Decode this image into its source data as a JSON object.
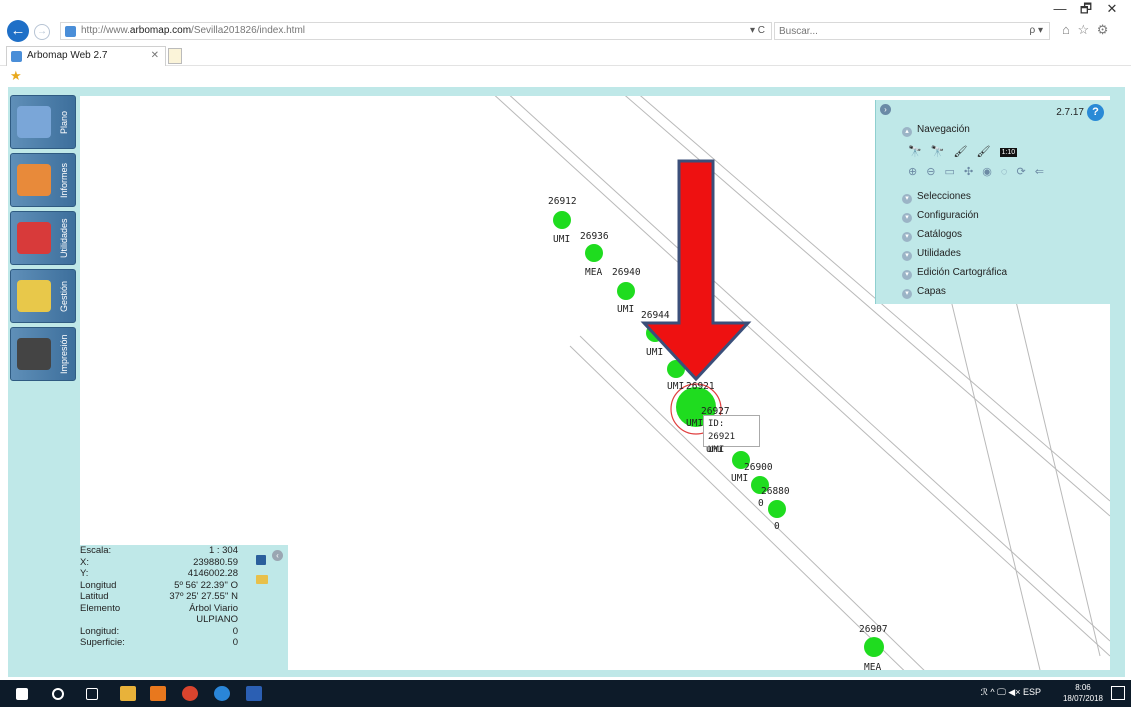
{
  "browser": {
    "url_prefix": "http://www.",
    "url_domain": "arbomap.com",
    "url_path": "/Sevilla201826/index.html",
    "url_controls": "▾ C",
    "search_placeholder": "Buscar...",
    "search_icon": "ρ ▾",
    "tab_title": "Arbomap Web 2.7",
    "tab_close": "✕",
    "window_controls": [
      "—",
      "🗗",
      "✕"
    ],
    "toolbar_icons": "⌂ ☆ ⚙"
  },
  "sidebar": {
    "tabs": [
      {
        "label": "Plano",
        "icon": "monitor-icon",
        "color": "#7aa6d8"
      },
      {
        "label": "Informes",
        "icon": "report-icon",
        "color": "#e88a3a"
      },
      {
        "label": "Utilidades",
        "icon": "tools-icon",
        "color": "#d83a3a"
      },
      {
        "label": "Gestión",
        "icon": "management-icon",
        "color": "#e8c84a"
      },
      {
        "label": "Impresión",
        "icon": "printer-icon",
        "color": "#444444"
      }
    ]
  },
  "panel": {
    "version": "2.7.17",
    "help": "?",
    "sections": [
      {
        "label": "Navegación",
        "expanded": true
      },
      {
        "label": "Selecciones",
        "expanded": false
      },
      {
        "label": "Configuración",
        "expanded": false
      },
      {
        "label": "Catálogos",
        "expanded": false
      },
      {
        "label": "Utilidades",
        "expanded": false
      },
      {
        "label": "Edición Cartográfica",
        "expanded": false
      },
      {
        "label": "Capas",
        "expanded": false
      }
    ],
    "nav_icons_row1": "🔭 🔭 🖌 🖌",
    "scale_button": "1:10",
    "nav_icons_row2": "⊕ ⊖ ▭ ✣ ◉ ◌ ⟳ ⇐"
  },
  "map": {
    "trees": [
      {
        "id": "26912",
        "type": "UMI"
      },
      {
        "id": "26936",
        "type": "MEA"
      },
      {
        "id": "26940",
        "type": "UMI"
      },
      {
        "id": "26944",
        "type": "UMI"
      },
      {
        "id": "26921",
        "type": "UMI",
        "selected": true
      },
      {
        "id": "26927",
        "type": "UMI"
      },
      {
        "id": "26900",
        "type": "UMI"
      },
      {
        "id": "26880",
        "type": "0"
      },
      {
        "id": "",
        "type": "0"
      },
      {
        "id": "26907",
        "type": "MEA"
      }
    ],
    "tooltip": {
      "line1": "ID: 26921",
      "line2": "UMI"
    },
    "tree_color": "#1fdc1f",
    "arrow_color": "#ee1111"
  },
  "info": {
    "rows": [
      {
        "key": "Escala:",
        "value": "1 : 304"
      },
      {
        "key": "X:",
        "value": "239880.59"
      },
      {
        "key": "Y:",
        "value": "4146002.28"
      },
      {
        "key": "Longitud",
        "value": "5º 56' 22.39'' O"
      },
      {
        "key": "Latitud",
        "value": "37º 25' 27.55'' N"
      },
      {
        "key": "Elemento",
        "value": "Árbol Viario"
      },
      {
        "key": "",
        "value": "ULPIANO"
      },
      {
        "key": "Longitud:",
        "value": "0"
      },
      {
        "key": "Superficie:",
        "value": "0"
      }
    ]
  },
  "taskbar": {
    "tray": "ℛ  ^  🖵 ◀×  ESP",
    "time": "8:06",
    "date": "18/07/2018"
  }
}
